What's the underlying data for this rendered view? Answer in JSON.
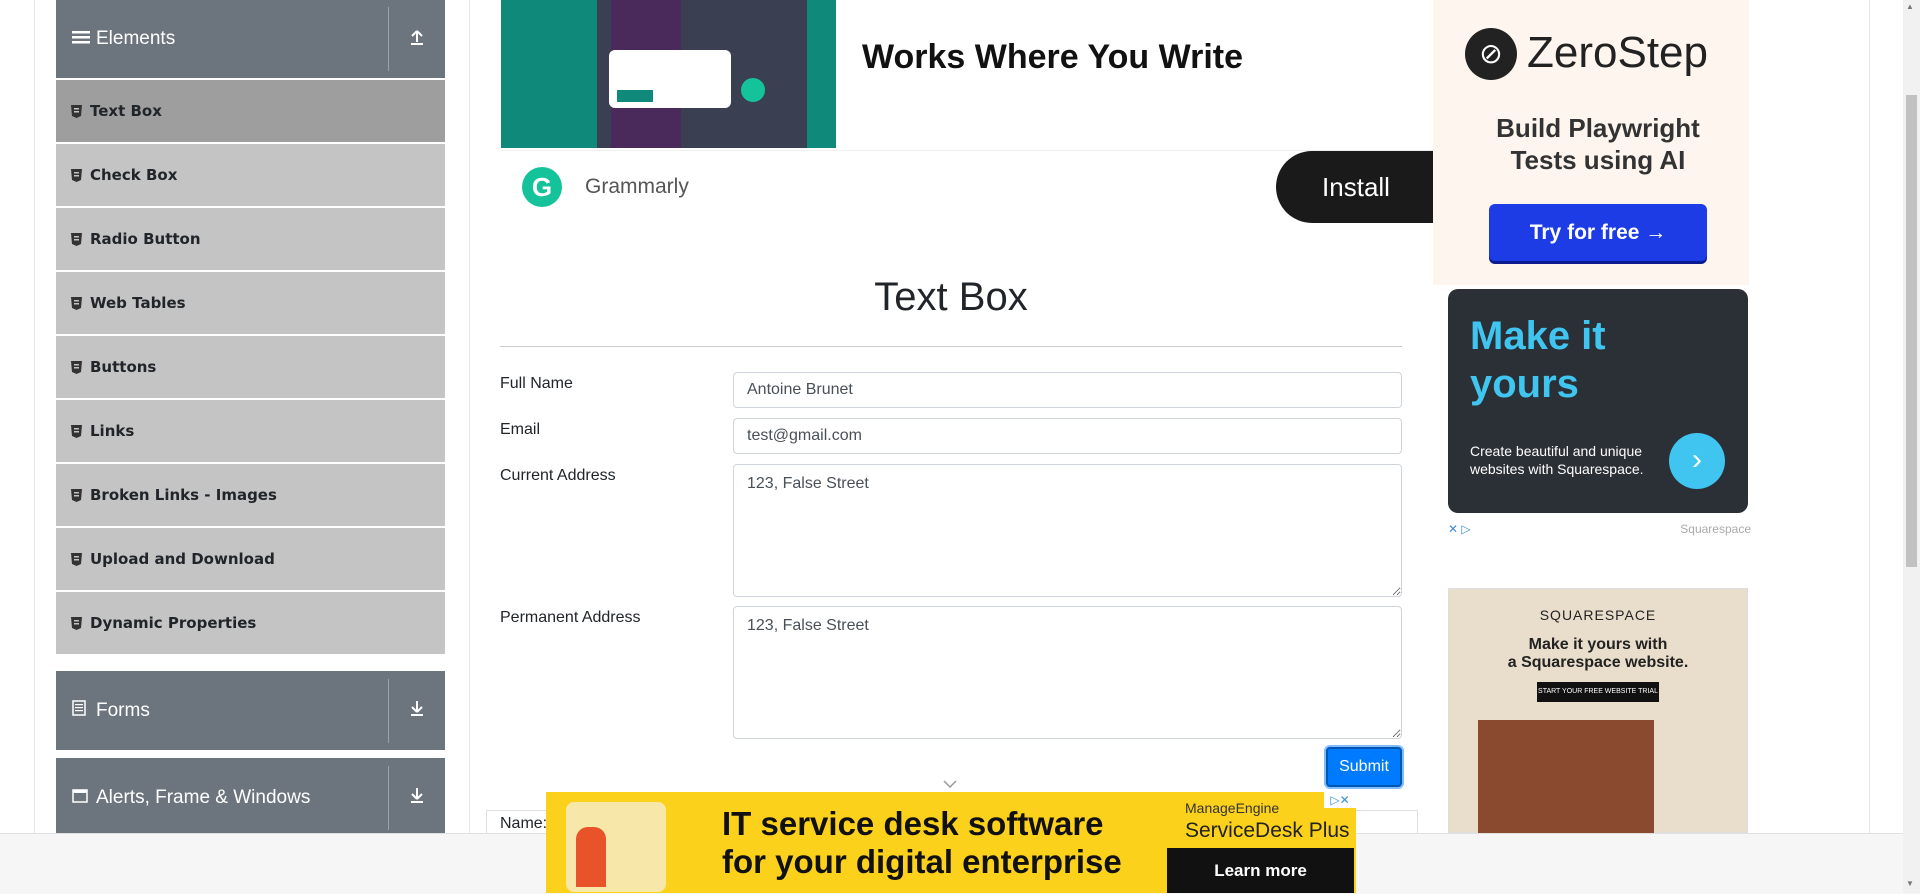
{
  "sidebar": {
    "elements_header": {
      "label": "Elements",
      "icon": "hamburger-icon",
      "toggle_icon": "upload-arrow-icon"
    },
    "items": [
      {
        "label": "Text Box",
        "active": true
      },
      {
        "label": "Check Box"
      },
      {
        "label": "Radio Button"
      },
      {
        "label": "Web Tables"
      },
      {
        "label": "Buttons"
      },
      {
        "label": "Links"
      },
      {
        "label": "Broken Links - Images"
      },
      {
        "label": "Upload and Download"
      },
      {
        "label": "Dynamic Properties"
      }
    ],
    "forms_header": {
      "label": "Forms",
      "icon": "document-icon",
      "toggle_icon": "download-arrow-icon"
    },
    "alerts_header": {
      "label": "Alerts, Frame & Windows",
      "icon": "window-icon",
      "toggle_icon": "download-arrow-icon"
    }
  },
  "ad_top": {
    "headline": "Works Where You Write",
    "brand": "Grammarly",
    "button": "Install",
    "logo_letter": "G"
  },
  "main": {
    "title": "Text Box",
    "fields": {
      "full_name_label": "Full Name",
      "full_name_value": "Antoine Brunet",
      "email_label": "Email",
      "email_value": "test@gmail.com",
      "current_address_label": "Current Address",
      "current_address_value": "123, False Street",
      "permanent_address_label": "Permanent Address",
      "permanent_address_value": "123, False Street"
    },
    "submit_label": "Submit",
    "output_name_label": "Name:"
  },
  "ad_zerostep": {
    "brand": "ZeroStep",
    "headline_1": "Build Playwright",
    "headline_2": "Tests using AI",
    "button": "Try for free →"
  },
  "ad_squarespace": {
    "headline_1": "Make it",
    "headline_2": "yours",
    "sub": "Create beautiful and unique websites with Squarespace.",
    "brand": "Squarespace",
    "arrow": "›"
  },
  "ad_squarespace2": {
    "brand": "SQUARESPACE",
    "headline_1": "Make it yours with",
    "headline_2": "a Squarespace website.",
    "button": "START YOUR FREE WEBSITE TRIAL"
  },
  "ad_bottom": {
    "line_1": "IT service desk software",
    "line_2": "for your digital enterprise",
    "brand_1": "ManageEngine",
    "brand_2": "ServiceDesk Plus",
    "button": "Learn more"
  },
  "colors": {
    "sidebar_header": "#6c757d",
    "sidebar_item": "#c4c4c4",
    "sidebar_item_active": "#9e9e9e",
    "submit": "#007bff",
    "ad_bottom_bg": "#fbd11b",
    "zerostep_button": "#1d3ce6",
    "squarespace_accent": "#3fc5f0"
  }
}
